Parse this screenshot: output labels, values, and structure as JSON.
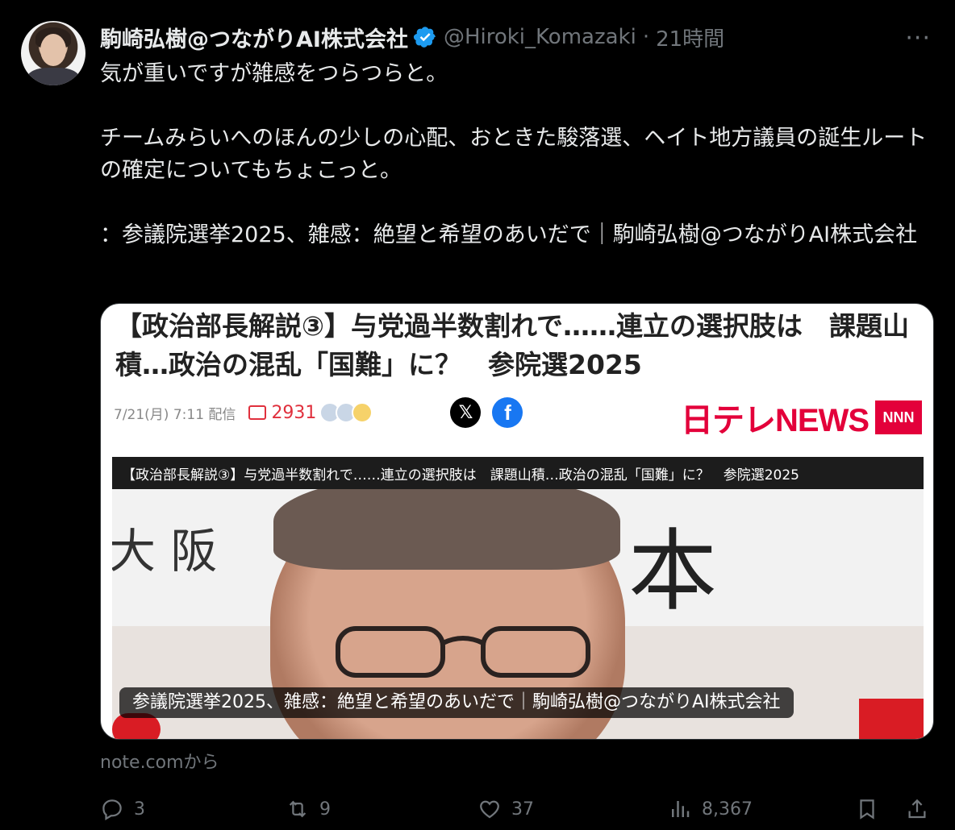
{
  "author": {
    "name": "駒崎弘樹@つながりAI株式会社",
    "handle": "@Hiroki_Komazaki",
    "separator": "·",
    "time": "21時間"
  },
  "more_label": "···",
  "post": {
    "lines": [
      "気が重いですが雑感をつらつらと。",
      "チームみらいへのほんの少しの心配、おときた駿落選、ヘイト地方議員の誕生ルートの確定についてもちょこっと。",
      "：参議院選挙2025、雑感：絶望と希望のあいだで｜駒崎弘樹@つながりAI株式会社"
    ]
  },
  "card": {
    "article_title": "【政治部長解説③】与党過半数割れで……連立の選択肢は　課題山積…政治の混乱「国難」に？　参院選2025",
    "date": "7/21(月) 7:11 配信",
    "comments": "2931",
    "x_label": "𝕏",
    "fb_label": "f",
    "logo_text": "日テレNEWS",
    "logo_badge": "NNN",
    "video_title": "【政治部長解説③】与党過半数割れで……連立の選択肢は　課題山積…政治の混乱「国難」に？　参院選2025",
    "video_sign_left": "大 阪",
    "video_sign_right": "本",
    "caption": "参議院選挙2025、雑感：絶望と希望のあいだで｜駒崎弘樹@つながりAI株式会社"
  },
  "source": "note.comから",
  "actions": {
    "replies": "3",
    "reposts": "9",
    "likes": "37",
    "views": "8,367"
  },
  "colors": {
    "background": "#000000",
    "text": "#e7e9ea",
    "muted": "#71767b",
    "verified": "#1d9bf0",
    "ntv_red": "#e3003a"
  }
}
